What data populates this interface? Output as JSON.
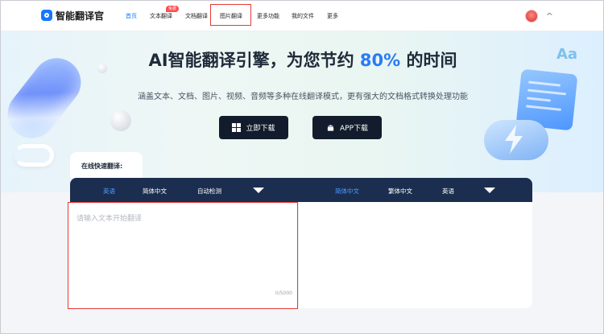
{
  "header": {
    "logo_text": "智能翻译官",
    "nav": [
      {
        "label": "首页",
        "active": true
      },
      {
        "label": "文本翻译",
        "badge": "免费"
      },
      {
        "label": "文档翻译"
      },
      {
        "label": "图片翻译",
        "highlighted": true
      },
      {
        "label": "更多功能"
      },
      {
        "label": "我的文件"
      },
      {
        "label": "更多"
      }
    ]
  },
  "hero": {
    "title_prefix": "AI智能翻译引擎，为您节约",
    "title_accent": "80%",
    "title_suffix": "的时间",
    "subtitle": "涵盖文本、文档、图片、视频、音频等多种在线翻译模式，更有强大的文档格式转换处理功能",
    "btn_pc": "立即下载",
    "btn_app": "APP下载",
    "deco_aa": "Aa"
  },
  "translator": {
    "quick_label": "在线快速翻译:",
    "source_langs": [
      "英语",
      "简体中文",
      "自动检测"
    ],
    "target_langs": [
      "简体中文",
      "繁体中文",
      "英语"
    ],
    "placeholder": "请输入文本开始翻译",
    "counter": "0/5000"
  },
  "colors": {
    "accent": "#1677ff",
    "title_accent": "#2a7bf5",
    "lang_bar": "#1c2e4f",
    "button_dark": "#131c2c",
    "highlight_border": "#e53935"
  }
}
